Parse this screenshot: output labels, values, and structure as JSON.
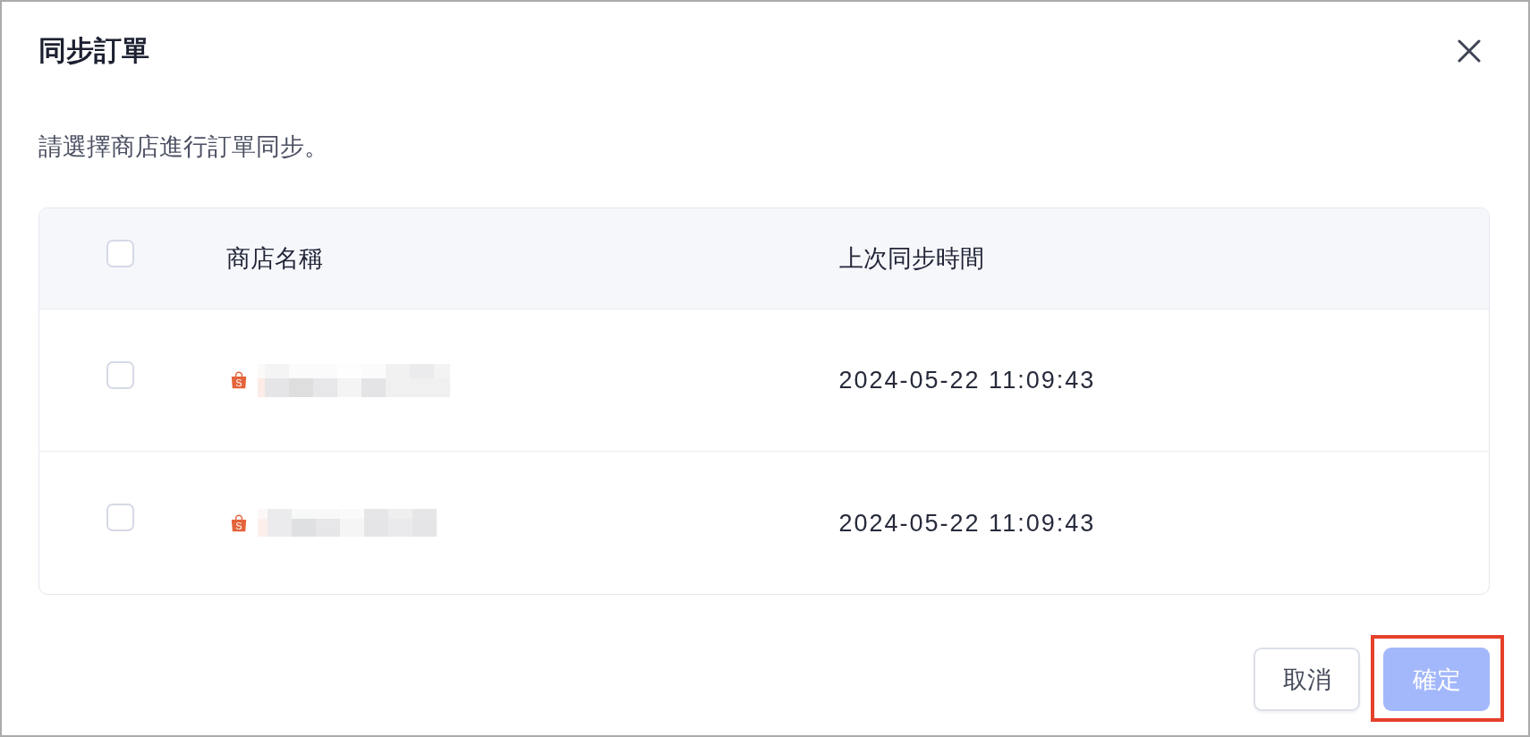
{
  "dialog": {
    "title": "同步訂單",
    "description": "請選擇商店進行訂單同步。"
  },
  "table": {
    "select_all": {
      "checked": false
    },
    "columns": [
      "商店名稱",
      "上次同步時間"
    ],
    "rows": [
      {
        "checked": false,
        "shop_logo_letter": "S",
        "name_pixelated": true,
        "last_sync": "2024-05-22 11:09:43"
      },
      {
        "checked": false,
        "shop_logo_letter": "S",
        "name_pixelated": true,
        "last_sync": "2024-05-22 11:09:43"
      }
    ]
  },
  "buttons": [
    {
      "label": "取消",
      "kind": "secondary",
      "disabled": false,
      "highlighted": false
    },
    {
      "label": "確定",
      "kind": "primary",
      "disabled": true,
      "highlighted": true
    }
  ]
}
